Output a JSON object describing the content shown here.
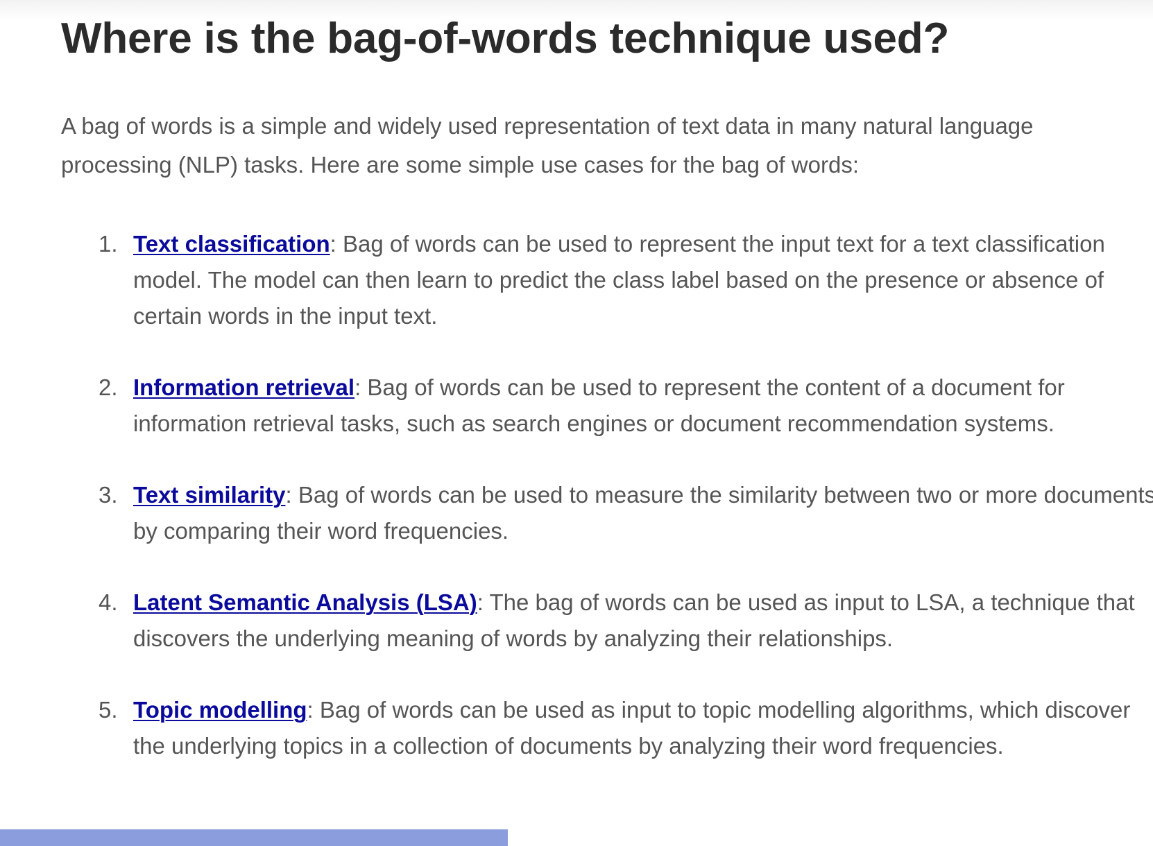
{
  "article": {
    "title": "Where is the bag-of-words technique used?",
    "intro": "A bag of words is a simple and widely used representation of text data in many natural language processing (NLP) tasks. Here are some simple use cases for the bag of words:",
    "items": [
      {
        "number": "1.",
        "link": "Text classification",
        "text": "Bag of words can be used to represent the input text for a text classification model. The model can then learn to predict the class label based on the presence or absence of certain words in the input text."
      },
      {
        "number": "2.",
        "link": "Information retrieval",
        "text": "Bag of words can be used to represent the content of a document for information retrieval tasks, such as search engines or document recommendation systems."
      },
      {
        "number": "3.",
        "link": "Text similarity",
        "text": "Bag of words can be used to measure the similarity between two or more documents by comparing their word frequencies."
      },
      {
        "number": "4.",
        "link": "Latent Semantic Analysis (LSA)",
        "text": "The bag of words can be used as input to LSA, a technique that discovers the underlying meaning of words by analyzing their relationships."
      },
      {
        "number": "5.",
        "link": "Topic modelling",
        "text": "Bag of words can be used as input to topic modelling algorithms, which discover the underlying topics in a collection of documents by analyzing their word frequencies."
      }
    ],
    "colon": ":"
  },
  "colors": {
    "heading": "#2b2b2b",
    "body_text": "#555555",
    "link": "#0a0a9c",
    "highlight_bar": "#8a9fdc"
  }
}
